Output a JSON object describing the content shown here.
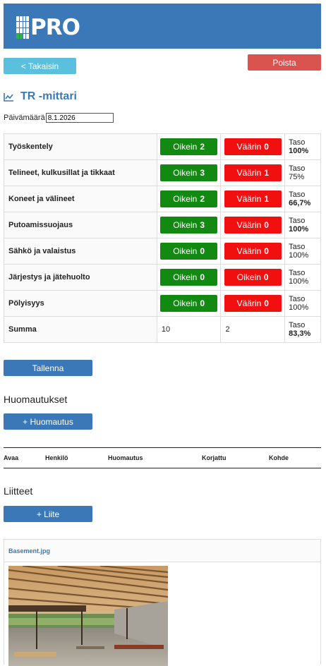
{
  "brand": {
    "logo_text": "PRO",
    "header_color": "#3a78b8"
  },
  "actions": {
    "back_label": "< Takaisin",
    "delete_label": "Poista"
  },
  "page": {
    "title": "TR -mittari",
    "date_label": "Päivämäärä",
    "date_value": "8.1.2026"
  },
  "table": {
    "rows": [
      {
        "category": "Työskentely",
        "ok_label": "Oikein",
        "ok_count": "2",
        "bad_label": "Väärin",
        "bad_count": "0",
        "level_label": "Taso",
        "level_value": "100%"
      },
      {
        "category": "Telineet, kulkusillat ja tikkaat",
        "ok_label": "Oikein",
        "ok_count": "3",
        "bad_label": "Väärin",
        "bad_count": "1",
        "level_label": "Taso",
        "level_value": "75%"
      },
      {
        "category": "Koneet ja välineet",
        "ok_label": "Oikein",
        "ok_count": "2",
        "bad_label": "Väärin",
        "bad_count": "1",
        "level_label": "Taso",
        "level_value": "66,7%"
      },
      {
        "category": "Putoamissuojaus",
        "ok_label": "Oikein",
        "ok_count": "3",
        "bad_label": "Väärin",
        "bad_count": "0",
        "level_label": "Taso",
        "level_value": "100%"
      },
      {
        "category": "Sähkö ja valaistus",
        "ok_label": "Oikein",
        "ok_count": "0",
        "bad_label": "Väärin",
        "bad_count": "0",
        "level_label": "Taso",
        "level_value": "100%"
      },
      {
        "category": "Järjestys ja jätehuolto",
        "ok_label": "Oikein",
        "ok_count": "0",
        "bad_label": "Oikein",
        "bad_count": "0",
        "level_label": "Taso",
        "level_value": "100%"
      },
      {
        "category": "Pölyisyys",
        "ok_label": "Oikein",
        "ok_count": "0",
        "bad_label": "Väärin",
        "bad_count": "0",
        "level_label": "Taso",
        "level_value": "100%"
      }
    ],
    "summary": {
      "label": "Summa",
      "ok_total": "10",
      "bad_total": "2",
      "level_label": "Taso",
      "level_value": "83,3%"
    },
    "ok_color": "#128a12",
    "bad_color": "#f10f0f"
  },
  "save_label": "Tallenna",
  "notes": {
    "heading": "Huomautukset",
    "add_label": "+ Huomautus",
    "columns": [
      "Avaa",
      "Henkilö",
      "Huomautus",
      "Korjattu",
      "Kohde"
    ]
  },
  "attachments": {
    "heading": "Liitteet",
    "add_label": "+ Liite",
    "items": [
      {
        "filename": "Basement.jpg"
      }
    ]
  }
}
